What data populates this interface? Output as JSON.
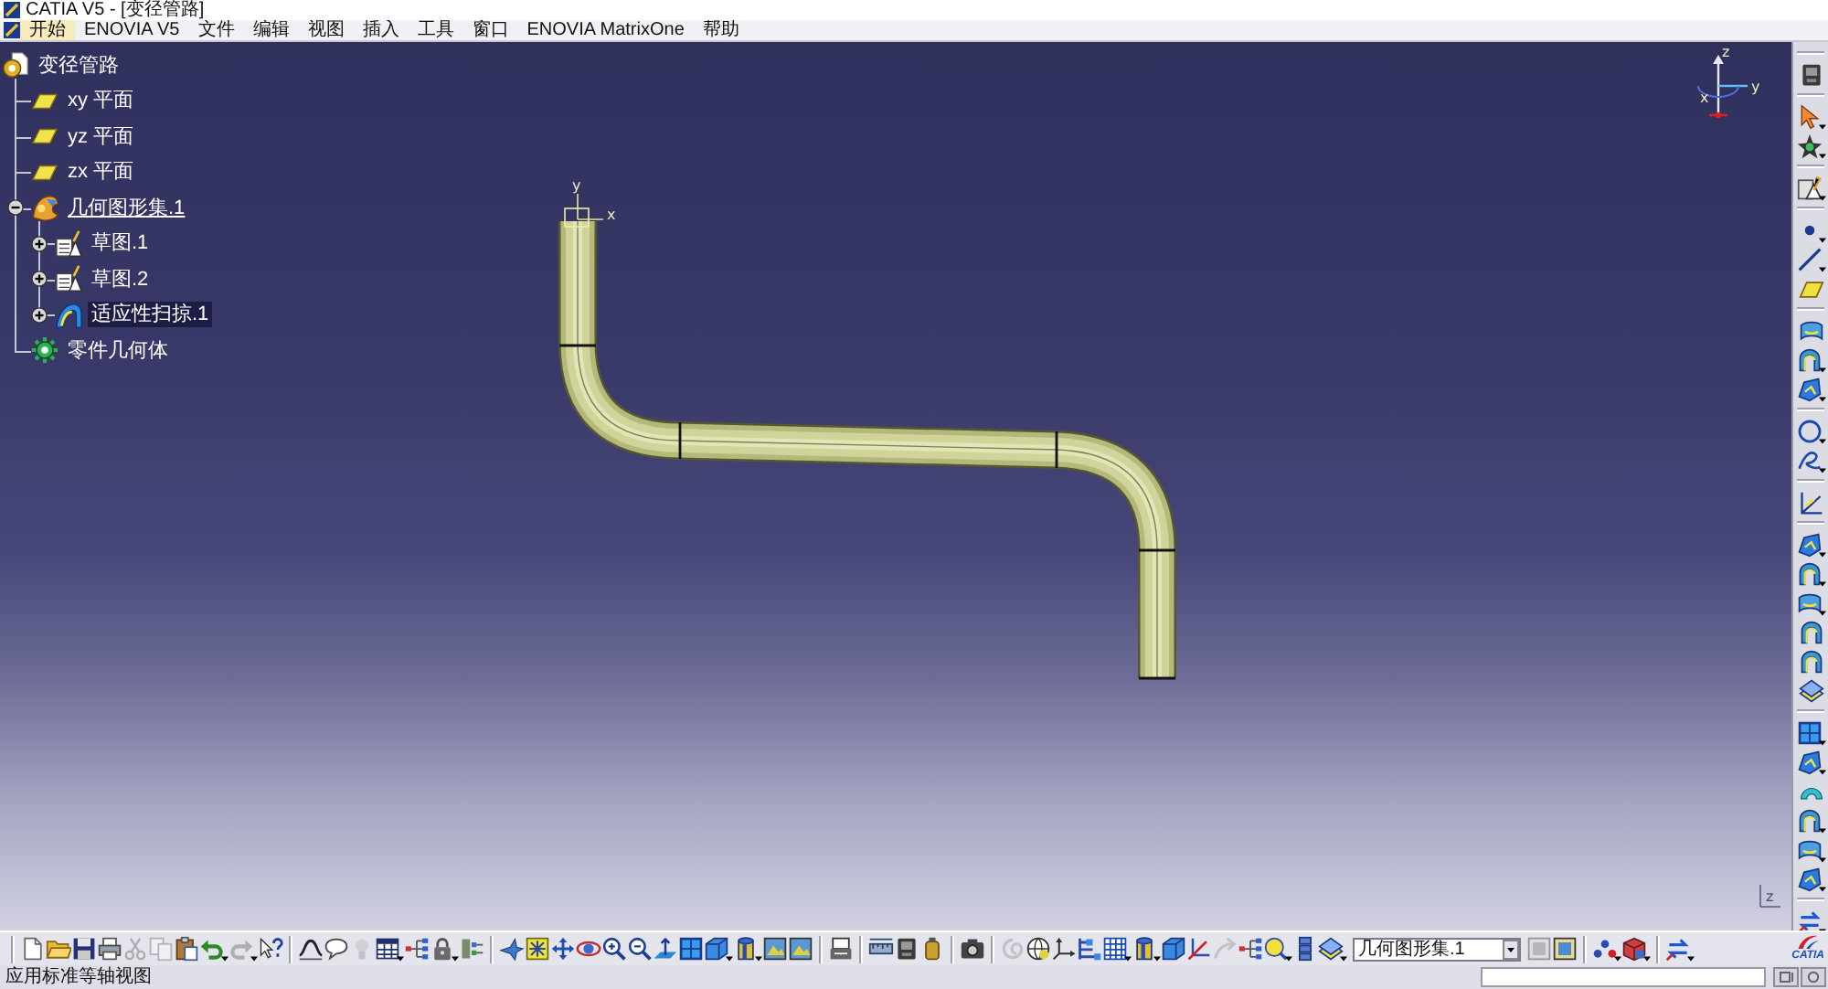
{
  "window": {
    "title": "CATIA V5 - [变径管路]"
  },
  "menu": [
    {
      "label": "开始",
      "selected": true
    },
    {
      "label": "ENOVIA V5",
      "selected": false
    },
    {
      "label": "文件",
      "selected": false
    },
    {
      "label": "编辑",
      "selected": false
    },
    {
      "label": "视图",
      "selected": false
    },
    {
      "label": "插入",
      "selected": false
    },
    {
      "label": "工具",
      "selected": false
    },
    {
      "label": "窗口",
      "selected": false
    },
    {
      "label": "ENOVIA MatrixOne",
      "selected": false
    },
    {
      "label": "帮助",
      "selected": false
    }
  ],
  "tree": {
    "label": "变径管路",
    "kind": "part",
    "selected": false,
    "current": false,
    "children": [
      {
        "label": "xy 平面",
        "kind": "plane",
        "selected": false,
        "current": false
      },
      {
        "label": "yz 平面",
        "kind": "plane",
        "selected": false,
        "current": false
      },
      {
        "label": "zx 平面",
        "kind": "plane",
        "selected": false,
        "current": false
      },
      {
        "label": "几何图形集.1",
        "kind": "geoset",
        "selected": false,
        "current": true,
        "expanded": true,
        "children": [
          {
            "label": "草图.1",
            "kind": "sketch",
            "selected": false,
            "current": false,
            "expanded": false
          },
          {
            "label": "草图.2",
            "kind": "sketch",
            "selected": false,
            "current": false,
            "expanded": false
          },
          {
            "label": "适应性扫掠.1",
            "kind": "sweep",
            "selected": true,
            "current": false,
            "expanded": false
          }
        ]
      },
      {
        "label": "零件几何体",
        "kind": "body",
        "selected": false,
        "current": false
      }
    ]
  },
  "viewer": {
    "sketch_axis_labels": [
      "y",
      "x"
    ],
    "compass_labels": [
      "z",
      "y",
      "x"
    ],
    "corner_axis_label": "z"
  },
  "right_toolbar": [
    [
      {
        "kind": "device",
        "disabled": false,
        "dropdown": false
      }
    ],
    [
      {
        "kind": "pointer",
        "disabled": false,
        "dropdown": true
      },
      {
        "kind": "star",
        "disabled": false,
        "dropdown": true
      }
    ],
    [
      {
        "kind": "sketch",
        "disabled": false,
        "dropdown": true
      }
    ],
    [
      {
        "kind": "point",
        "disabled": false,
        "dropdown": true
      },
      {
        "kind": "line",
        "disabled": false,
        "dropdown": true
      },
      {
        "kind": "plane",
        "disabled": false,
        "dropdown": false
      }
    ],
    [
      {
        "kind": "surface",
        "disabled": false,
        "dropdown": false
      },
      {
        "kind": "arch",
        "disabled": false,
        "dropdown": true
      },
      {
        "kind": "patch",
        "disabled": false,
        "dropdown": true
      }
    ],
    [
      {
        "kind": "circle",
        "disabled": false,
        "dropdown": true
      },
      {
        "kind": "spline",
        "disabled": false,
        "dropdown": true
      }
    ],
    [
      {
        "kind": "corner",
        "disabled": false,
        "dropdown": false
      }
    ],
    [
      {
        "kind": "patch",
        "disabled": false,
        "dropdown": true
      },
      {
        "kind": "arch",
        "disabled": false,
        "dropdown": true
      },
      {
        "kind": "surface",
        "disabled": false,
        "dropdown": true
      },
      {
        "kind": "arch",
        "disabled": false,
        "dropdown": false
      },
      {
        "kind": "arch",
        "disabled": false,
        "dropdown": false
      },
      {
        "kind": "layers",
        "disabled": false,
        "dropdown": false
      }
    ],
    [
      {
        "kind": "quad",
        "disabled": false,
        "dropdown": true
      },
      {
        "kind": "patch",
        "disabled": false,
        "dropdown": true
      },
      {
        "kind": "arc",
        "disabled": false,
        "dropdown": false
      },
      {
        "kind": "arch",
        "disabled": false,
        "dropdown": true
      },
      {
        "kind": "surface",
        "disabled": false,
        "dropdown": true
      },
      {
        "kind": "patch",
        "disabled": false,
        "dropdown": true
      }
    ],
    [
      {
        "kind": "swap",
        "disabled": false,
        "dropdown": true
      }
    ]
  ],
  "bottom_toolbar": [
    [
      {
        "kind": "page",
        "disabled": false,
        "dropdown": false
      },
      {
        "kind": "folder",
        "disabled": false,
        "dropdown": false
      },
      {
        "kind": "floppy",
        "disabled": false,
        "dropdown": false
      },
      {
        "kind": "printer",
        "disabled": false,
        "dropdown": false
      },
      {
        "kind": "scissors",
        "disabled": true,
        "dropdown": false
      },
      {
        "kind": "copy",
        "disabled": true,
        "dropdown": false
      },
      {
        "kind": "clipboard",
        "disabled": false,
        "dropdown": false
      },
      {
        "kind": "undo",
        "disabled": false,
        "dropdown": true
      },
      {
        "kind": "redo",
        "disabled": true,
        "dropdown": true
      },
      {
        "kind": "help",
        "disabled": false,
        "dropdown": false
      }
    ],
    [
      {
        "kind": "curve",
        "disabled": false,
        "dropdown": false
      },
      {
        "kind": "bubble",
        "disabled": false,
        "dropdown": false
      },
      {
        "kind": "bulb",
        "disabled": true,
        "dropdown": false
      },
      {
        "kind": "table",
        "disabled": false,
        "dropdown": true
      },
      {
        "kind": "graph",
        "disabled": false,
        "dropdown": false
      },
      {
        "kind": "padlock",
        "disabled": false,
        "dropdown": true
      },
      {
        "kind": "panel",
        "disabled": false,
        "dropdown": false
      }
    ],
    [
      {
        "kind": "flight",
        "disabled": false,
        "dropdown": false
      },
      {
        "kind": "fit",
        "disabled": false,
        "dropdown": false
      },
      {
        "kind": "pan",
        "disabled": false,
        "dropdown": false
      },
      {
        "kind": "rotate",
        "disabled": false,
        "dropdown": false
      },
      {
        "kind": "zoomin",
        "disabled": false,
        "dropdown": false
      },
      {
        "kind": "zoomout",
        "disabled": false,
        "dropdown": false
      },
      {
        "kind": "normal",
        "disabled": false,
        "dropdown": false
      },
      {
        "kind": "quad",
        "disabled": false,
        "dropdown": false
      },
      {
        "kind": "cube",
        "disabled": false,
        "dropdown": true
      },
      {
        "kind": "cylinder",
        "disabled": false,
        "dropdown": true
      },
      {
        "kind": "image",
        "disabled": false,
        "dropdown": false
      },
      {
        "kind": "image",
        "disabled": false,
        "dropdown": false
      }
    ],
    [
      {
        "kind": "hide",
        "disabled": false,
        "dropdown": false
      }
    ],
    [
      {
        "kind": "ruler",
        "disabled": false,
        "dropdown": false
      },
      {
        "kind": "device",
        "disabled": false,
        "dropdown": false
      },
      {
        "kind": "canister",
        "disabled": false,
        "dropdown": false
      }
    ],
    [
      {
        "kind": "camera",
        "disabled": false,
        "dropdown": false
      }
    ],
    [
      {
        "kind": "spiral",
        "disabled": true,
        "dropdown": false
      },
      {
        "kind": "globe",
        "disabled": false,
        "dropdown": false
      },
      {
        "kind": "axes",
        "disabled": false,
        "dropdown": false
      },
      {
        "kind": "hierarchy",
        "disabled": false,
        "dropdown": false
      },
      {
        "kind": "grid",
        "disabled": false,
        "dropdown": true
      },
      {
        "kind": "cylinder",
        "disabled": false,
        "dropdown": true
      },
      {
        "kind": "cube",
        "disabled": false,
        "dropdown": false
      },
      {
        "kind": "slant",
        "disabled": false,
        "dropdown": false
      },
      {
        "kind": "curvedarrow",
        "disabled": true,
        "dropdown": false
      },
      {
        "kind": "graph",
        "disabled": false,
        "dropdown": false
      },
      {
        "kind": "magnifier",
        "disabled": false,
        "dropdown": true
      },
      {
        "kind": "stack",
        "disabled": false,
        "dropdown": false
      },
      {
        "kind": "layers",
        "disabled": false,
        "dropdown": true
      },
      {
        "kind": "select",
        "value": "几何图形集.1"
      },
      {
        "kind": "frame",
        "disabled": true,
        "dropdown": false
      },
      {
        "kind": "frame",
        "disabled": false,
        "dropdown": false
      }
    ],
    [
      {
        "kind": "dots",
        "disabled": false,
        "dropdown": true
      },
      {
        "kind": "block",
        "disabled": false,
        "dropdown": true
      }
    ],
    [
      {
        "kind": "swap",
        "disabled": false,
        "dropdown": true
      }
    ]
  ],
  "logo": {
    "text": "CATIA"
  },
  "status_bar": {
    "message": "应用标准等轴视图"
  }
}
